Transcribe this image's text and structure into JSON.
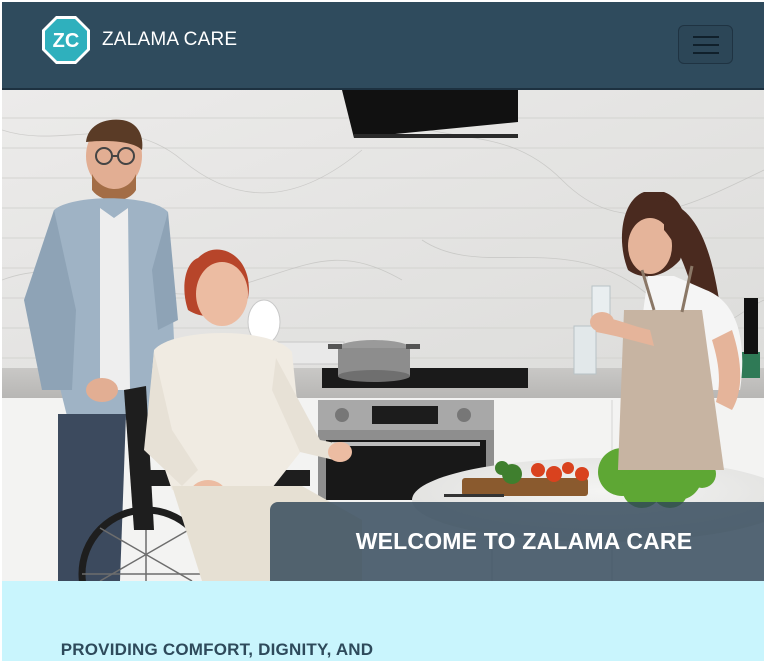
{
  "navbar": {
    "brand_initials": "ZC",
    "brand_name": "ZALAMA CARE",
    "menu_icon": "hamburger-icon"
  },
  "hero": {
    "title": "WELCOME TO ZALAMA CARE",
    "image": "photo-caregivers-kitchen-wheelchair"
  },
  "about": {
    "heading": "PROVIDING COMFORT, DIGNITY, AND INDEPENDENCE"
  },
  "colors": {
    "navbar_bg": "#2f4b5d",
    "logo_teal": "#2fb0bd",
    "about_bg": "#c9f5fd",
    "heading_text": "#2e4a5b"
  }
}
